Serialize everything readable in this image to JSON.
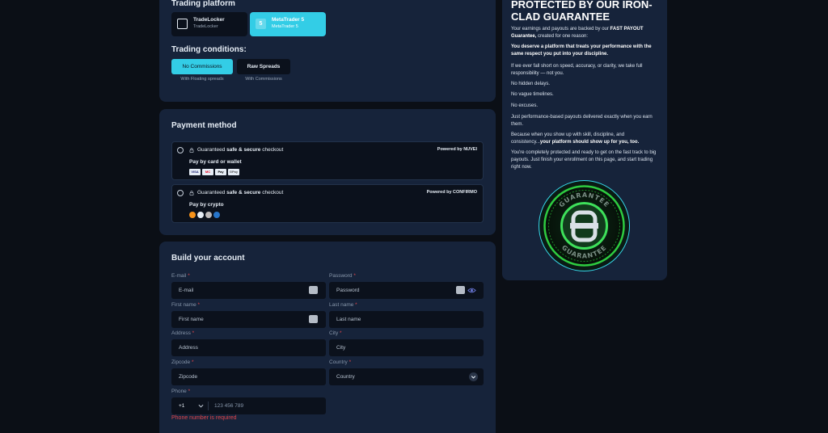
{
  "trading": {
    "platform_title": "Trading platform",
    "platforms": [
      {
        "name": "TradeLocker",
        "sub": "TradeLocker",
        "icon": "tradelocker-icon"
      },
      {
        "name": "MetaTrader 5",
        "sub": "MetaTrader 5",
        "icon": "metatrader-icon",
        "icon_glyph": "5",
        "selected": true
      }
    ],
    "conditions_title": "Trading conditions:",
    "conditions": [
      {
        "label": "No Commissions",
        "sub": "With Floating spreads",
        "selected": true
      },
      {
        "label": "Raw Spreads",
        "sub": "With Commissions"
      }
    ]
  },
  "payment": {
    "title": "Payment method",
    "options": [
      {
        "head_pre": "Guaranteed ",
        "head_bold": "safe & secure",
        "head_post": " checkout",
        "powered_pre": "Powered by ",
        "powered_name": "NUVEI",
        "sub": "Pay by card or wallet",
        "logos": [
          "VISA",
          "MC",
          "Pay",
          "GPay"
        ]
      },
      {
        "head_pre": "Guaranteed ",
        "head_bold": "safe & secure",
        "head_post": " checkout",
        "powered_pre": "Powered by ",
        "powered_name": "CONFIRMO",
        "sub": "Pay by crypto",
        "logos": [
          "btc",
          "eth",
          "ltc",
          "usdc"
        ]
      }
    ]
  },
  "account": {
    "title": "Build your account",
    "email_label": "E-mail",
    "email_placeholder": "E-mail",
    "password_label": "Password",
    "password_placeholder": "Password",
    "firstname_label": "First name",
    "firstname_placeholder": "First name",
    "lastname_label": "Last name",
    "lastname_placeholder": "Last name",
    "address_label": "Address",
    "address_placeholder": "Address",
    "city_label": "City",
    "city_placeholder": "City",
    "zip_label": "Zipcode",
    "zip_placeholder": "Zipcode",
    "country_label": "Country",
    "country_placeholder": "Country",
    "phone_label": "Phone",
    "phone_code": "+1",
    "phone_placeholder": "123 456 789",
    "phone_error": "Phone number is required",
    "required_mark": "*"
  },
  "guarantee": {
    "title": "PROTECTED BY OUR IRON-CLAD GUARANTEE",
    "p1_pre": "Your earnings and payouts are backed by our ",
    "p1_bold": "FAST PAYOUT Guarantee,",
    "p1_post": " created for one reason:",
    "p2": "You deserve a platform that treats your performance with the same respect you put into your discipline.",
    "p3": "If we ever fall short on speed, accuracy, or clarity, we take full responsibility — not you.",
    "p4": "No hidden delays.",
    "p5": "No vague timelines.",
    "p6": "No excuses.",
    "p7": "Just performance-based payouts delivered exactly when you earn them.",
    "p8_pre": "Because when you show up with skill, discipline, and consistency...",
    "p8_bold": "your platform should show up for you, too.",
    "p9": "You're completely protected and ready to get on the fast track to big payouts. Just finish your enrollment on this page, and start trading right now.",
    "badge_top": "GUARANTEE",
    "badge_bottom": "GUARANTEE"
  },
  "colors": {
    "accent": "#33cde6",
    "card": "#16233a",
    "input": "#0b111c",
    "error": "#e0454b",
    "badge": "#2ecc40"
  }
}
